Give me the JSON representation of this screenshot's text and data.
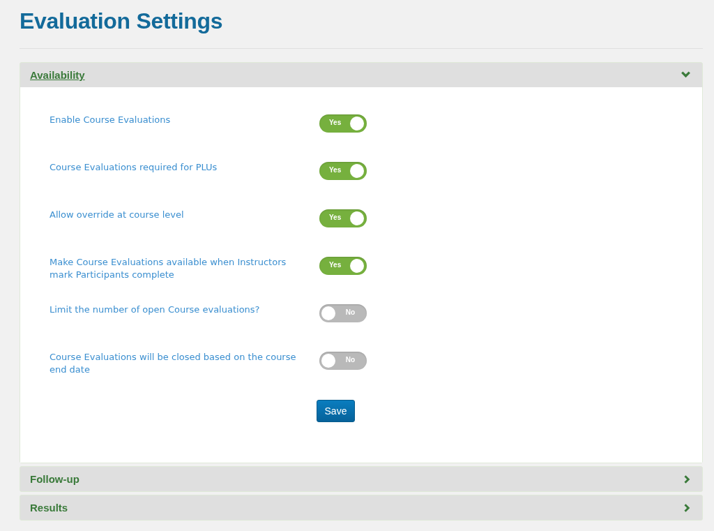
{
  "page": {
    "title": "Evaluation Settings"
  },
  "sections": [
    {
      "title": "Availability",
      "expanded": true,
      "settings": [
        {
          "label": "Enable Course Evaluations",
          "on": true,
          "toggle_text": "Yes"
        },
        {
          "label": "Course Evaluations required for PLUs",
          "on": true,
          "toggle_text": "Yes"
        },
        {
          "label": "Allow override at course level",
          "on": true,
          "toggle_text": "Yes"
        },
        {
          "label": "Make Course Evaluations available when Instructors mark Participants complete",
          "on": true,
          "toggle_text": "Yes"
        },
        {
          "label": "Limit the number of open Course evaluations?",
          "on": false,
          "toggle_text": "No"
        },
        {
          "label": "Course Evaluations will be closed based on the course end date",
          "on": false,
          "toggle_text": "No"
        }
      ],
      "save_button": "Save"
    },
    {
      "title": "Follow-up",
      "expanded": false
    },
    {
      "title": "Results",
      "expanded": false
    }
  ]
}
